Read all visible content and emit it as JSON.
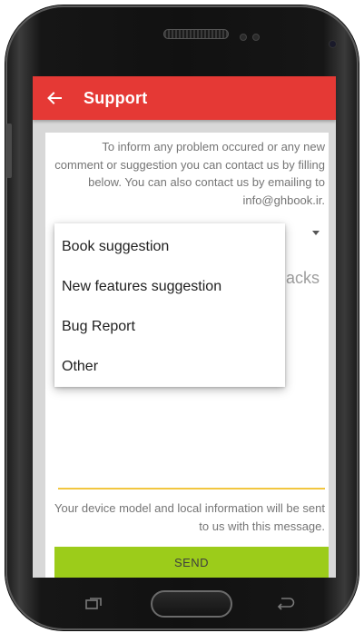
{
  "app_bar": {
    "title": "Support",
    "back_icon": "arrow-left-icon",
    "color": "#e53935"
  },
  "form": {
    "intro_text": "To inform any problem occured or any new comment or suggestion you can contact us by filling below. You can also contact us by emailing to info@ghbook.ir.",
    "message_hint_partial": "acks",
    "device_note": "Your device model and local information will be sent to us with this message.",
    "send_label": "SEND",
    "send_color": "#9ccc1a",
    "underline_color": "#f2c640"
  },
  "dropdown": {
    "options": [
      "Book suggestion",
      "New features suggestion",
      "Bug Report",
      "Other"
    ]
  },
  "nav": {
    "recents_icon": "recents-icon",
    "home_icon": "home-button",
    "back_icon": "back-icon"
  }
}
